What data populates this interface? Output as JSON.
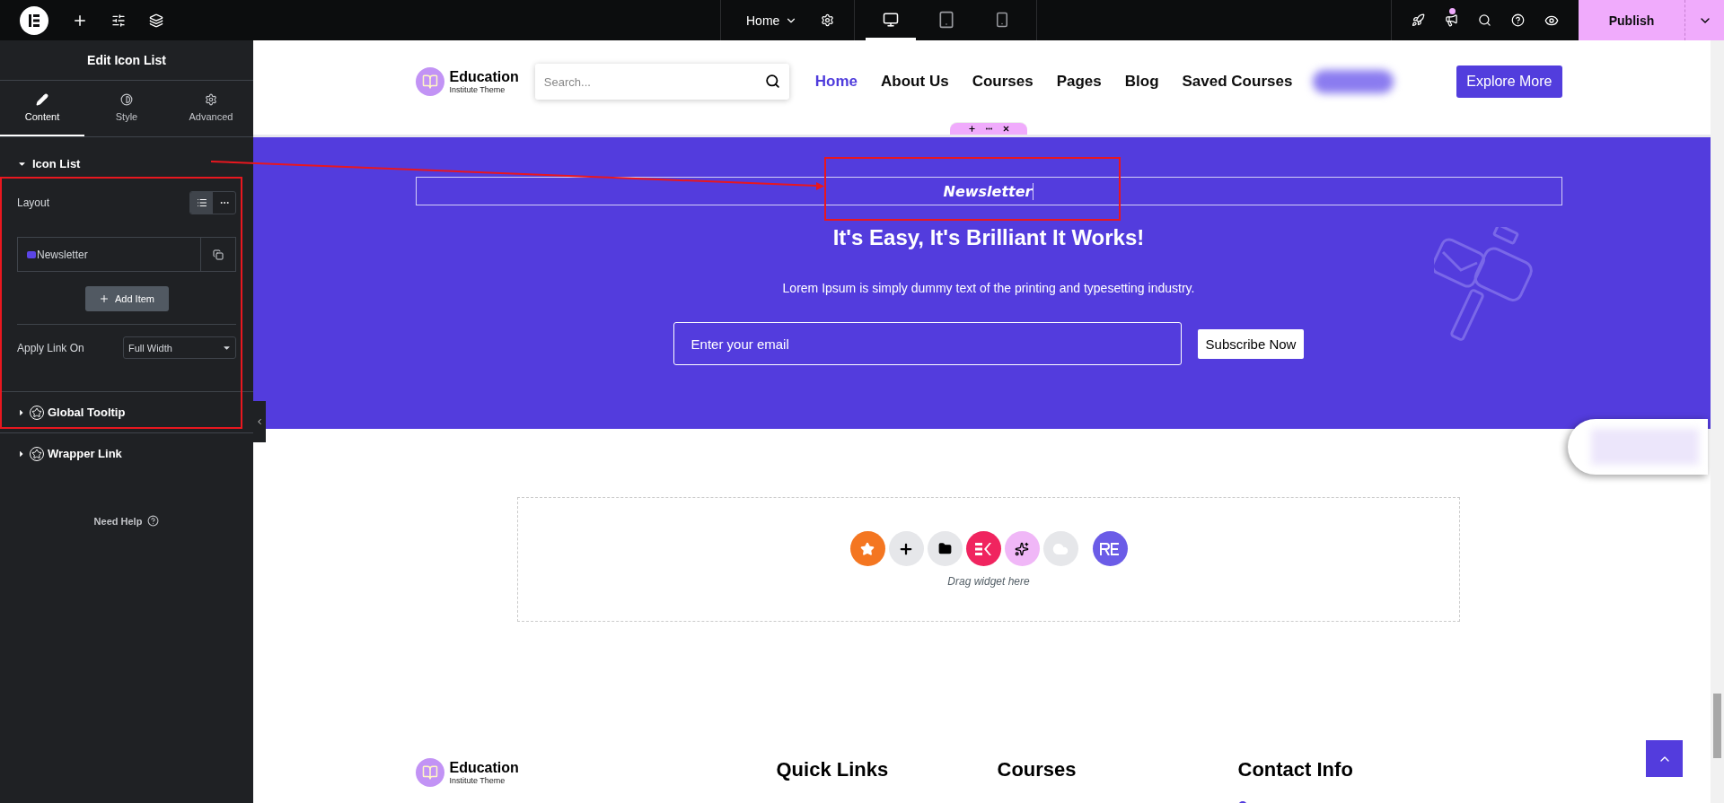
{
  "topbar": {
    "page_menu": "Home",
    "devices": [
      {
        "kind": "desktop",
        "selected": true
      },
      {
        "kind": "tablet",
        "selected": false
      },
      {
        "kind": "mobile",
        "selected": false
      }
    ],
    "publish": "Publish"
  },
  "sidebar": {
    "title": "Edit Icon List",
    "tabs": [
      {
        "label": "Content",
        "kind": "content",
        "selected": true
      },
      {
        "label": "Style",
        "kind": "style",
        "selected": false
      },
      {
        "label": "Advanced",
        "kind": "advanced",
        "selected": false
      }
    ],
    "section": {
      "title": "Icon List",
      "expanded": true,
      "layout_label": "Layout",
      "layout_options": [
        {
          "kind": "list",
          "selected": true
        },
        {
          "kind": "inline",
          "selected": false
        }
      ],
      "items": [
        {
          "label": "Newsletter"
        }
      ],
      "add_button": "Add Item",
      "link_label": "Apply Link On",
      "link_value": "Full Width"
    },
    "collapsed_sections": [
      {
        "title": "Global Tooltip",
        "expanded": false
      },
      {
        "title": "Wrapper Link",
        "expanded": false
      }
    ],
    "help": "Need Help"
  },
  "site_header": {
    "logo_title": "Education",
    "logo_subtitle": "Institute Theme",
    "search": {
      "placeholder": "Search..."
    },
    "nav": [
      {
        "label": "Home",
        "selected": true
      },
      {
        "label": "About Us",
        "selected": false
      },
      {
        "label": "Courses",
        "selected": false
      },
      {
        "label": "Pages",
        "selected": false
      },
      {
        "label": "Blog",
        "selected": false
      },
      {
        "label": "Saved Courses",
        "selected": false
      }
    ],
    "cta": "Explore More"
  },
  "newsletter": {
    "label": "Newsletter",
    "heading": "It's Easy, It's Brilliant It Works!",
    "text": "Lorem Ipsum is simply dummy text of the printing and typesetting industry.",
    "email": {
      "placeholder": "Enter your email"
    },
    "button": "Subscribe Now"
  },
  "dropzone": {
    "hint": "Drag widget here"
  },
  "footer": {
    "logo_title": "Education",
    "logo_subtitle": "Institute Theme",
    "columns": [
      "Quick Links",
      "Courses",
      "Contact Info"
    ]
  }
}
